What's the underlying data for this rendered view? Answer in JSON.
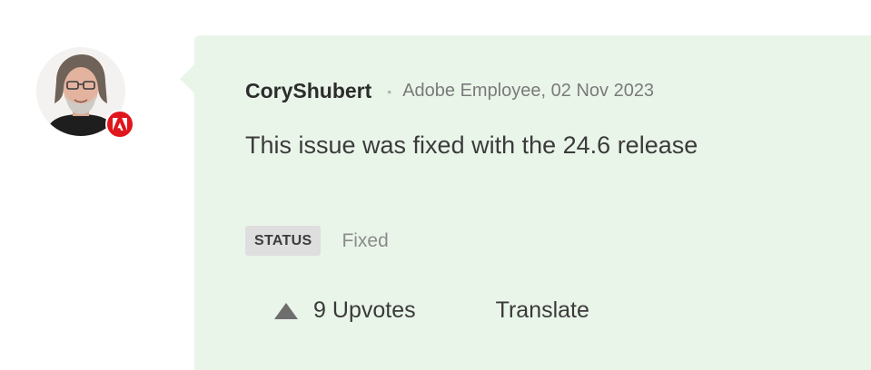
{
  "comment": {
    "author": "CoryShubert",
    "separator": "•",
    "role_date": "Adobe Employee, 02 Nov 2023",
    "body": "This issue was fixed with the 24.6 release",
    "status": {
      "label": "STATUS",
      "value": "Fixed"
    },
    "actions": {
      "upvote_count": "9",
      "upvote_label": "Upvotes",
      "translate_label": "Translate"
    }
  },
  "icons": {
    "avatar": "user-avatar-photo",
    "badge": "adobe-logo-icon",
    "upvote": "triangle-up-icon"
  },
  "colors": {
    "card_background": "#eaf5ea",
    "badge_red": "#e0161d",
    "status_badge_bg": "#dedede"
  }
}
